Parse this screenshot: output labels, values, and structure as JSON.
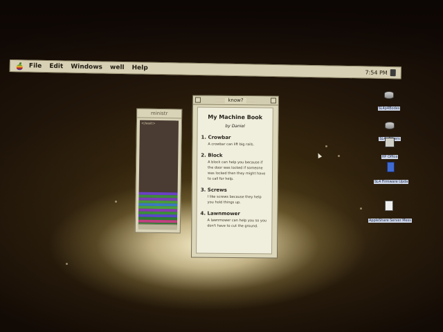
{
  "menubar": {
    "items": [
      "File",
      "Edit",
      "Windows",
      "well",
      "Help"
    ],
    "clock": "7:54 PM"
  },
  "small_window": {
    "title": "ministr",
    "content_label": "</wait>"
  },
  "main_window": {
    "title": "know?",
    "book_title": "My Machine Book",
    "author": "by Daniel",
    "entries": [
      {
        "heading": "1. Crowbar",
        "text": "A crowbar can lift big rails."
      },
      {
        "heading": "2. Block",
        "text": "A block can help you because if the door was locked if someone was locked then they might have to call for help."
      },
      {
        "heading": "3. Screws",
        "text": "I like screws because they help you hold things up."
      },
      {
        "heading": "4. Lawnmower",
        "text": "A lawnmower can help you so you don't have to cut the ground."
      }
    ]
  },
  "desktop_icons": [
    {
      "label": "SL4p4Bodes",
      "icon": "hard-disk-icon"
    },
    {
      "label": "SL4p4Users",
      "icon": "hard-disk-icon"
    },
    {
      "label": "HP Office",
      "icon": "printer-icon"
    },
    {
      "label": "SL4 Firmware Upda",
      "icon": "book-icon"
    },
    {
      "label": "AppleShare Server Mess",
      "icon": "document-icon"
    }
  ],
  "colors": {
    "menubar": "#d7d0b4",
    "window": "#dcd6bb",
    "page": "#f0eedd",
    "icon_label_bg": "#cfd6e6"
  }
}
